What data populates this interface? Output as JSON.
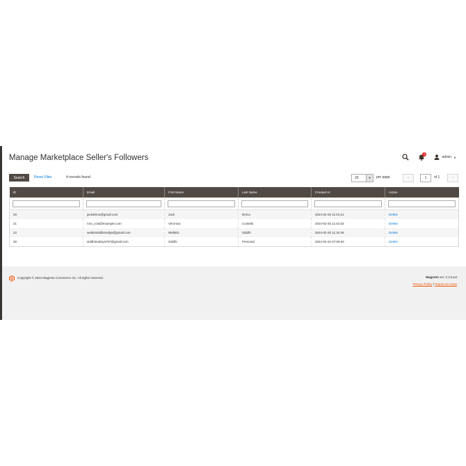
{
  "header": {
    "title": "Manage Marketplace Seller's Followers",
    "notifications_count": "1",
    "user_name": "admin"
  },
  "toolbar": {
    "search_label": "Search",
    "reset_filter_label": "Reset Filter",
    "records_found": "4 records found",
    "per_page_value": "20",
    "per_page_label": "per page",
    "current_page": "1",
    "page_of": "of 1"
  },
  "grid": {
    "columns": [
      "ID",
      "Email",
      "First Name",
      "Last Name",
      "Created At",
      "Action"
    ],
    "rows": [
      [
        "20",
        "jackdemo@gmail.com",
        "Jack",
        "Demo",
        "2024-02-20 11:01:21",
        "Delete"
      ],
      [
        "21",
        "roni_cost@example.com",
        "Veronica",
        "Costello",
        "2024-02-20 11:01:53",
        "Delete"
      ],
      [
        "22",
        "webkitsiddhimaliya@gmail.com",
        "Webkitc",
        "Siddhi",
        "2024-02-20 11:34:49",
        "Delete"
      ],
      [
        "30",
        "siddhimalviya757@gmail.com",
        "Siddhi",
        "Personal",
        "2024-02-22 07:09:34",
        "Delete"
      ]
    ]
  },
  "footer": {
    "copyright": "Copyright © 2024 Magento Commerce Inc. All rights reserved.",
    "brand": "Magento",
    "version": " ver. 2.4.6-p3",
    "privacy_link": "Privacy Policy",
    "separator": "|",
    "report_link": "Report an Issue"
  },
  "colors": {
    "header_bg": "#514943",
    "link": "#007bdb",
    "footer_link": "#eb5202",
    "badge": "#e22626"
  }
}
